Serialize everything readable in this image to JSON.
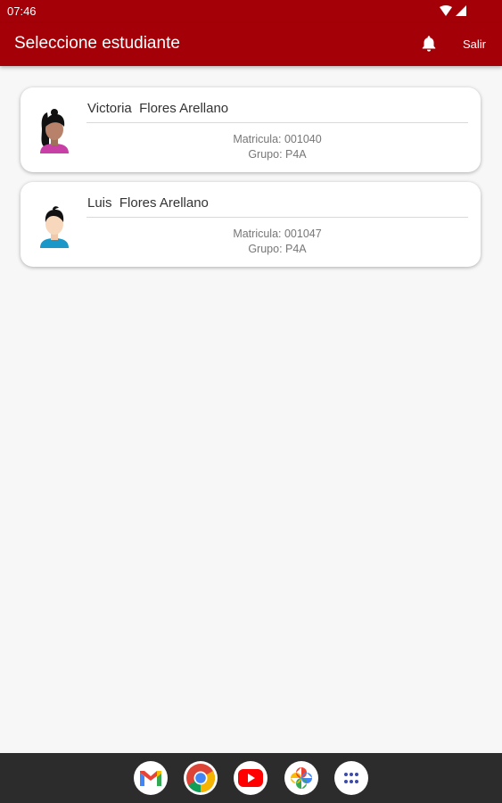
{
  "status_bar": {
    "time": "07:46"
  },
  "app_bar": {
    "title": "Seleccione estudiante",
    "logout_label": "Salir"
  },
  "students": [
    {
      "name": "Victoria  Flores Arellano",
      "matricula": "Matricula: 001040",
      "grupo": "Grupo: P4A"
    },
    {
      "name": "Luis  Flores Arellano",
      "matricula": "Matricula: 001047",
      "grupo": "Grupo: P4A"
    }
  ],
  "colors": {
    "primary": "#a30008",
    "background": "#f7f7f7",
    "card": "#ffffff",
    "nav_bar": "#2c2c2c"
  },
  "dock_apps": [
    "gmail-icon",
    "chrome-icon",
    "youtube-icon",
    "photos-icon",
    "app-drawer-icon"
  ]
}
